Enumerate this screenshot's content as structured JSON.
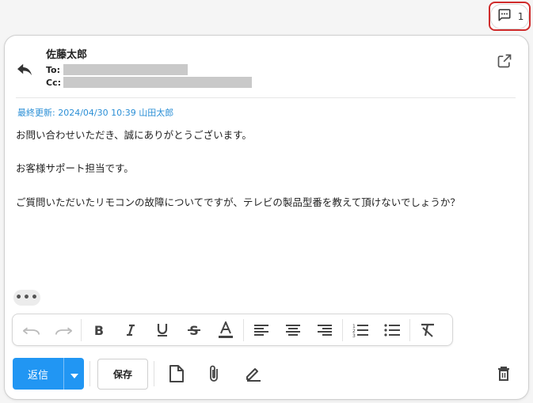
{
  "comments": {
    "count": "1",
    "icon": "comment-icon"
  },
  "message": {
    "sender": "佐藤太郎",
    "to_label": "To:",
    "cc_label": "Cc:",
    "last_updated": "最終更新: 2024/04/30 10:39 山田太郎",
    "body": [
      "お問い合わせいただき、誠にありがとうございます。",
      "お客様サポート担当です。",
      "ご質問いただいたリモコンの故障についてですが、テレビの製品型番を教えて頂けないでしょうか？"
    ],
    "more": "•••"
  },
  "toolbar": {
    "icons": [
      "undo-icon",
      "redo-icon",
      "bold-icon",
      "italic-icon",
      "underline-icon",
      "strikethrough-icon",
      "font-color-icon",
      "align-left-icon",
      "align-center-icon",
      "align-right-icon",
      "numbered-list-icon",
      "bulleted-list-icon",
      "clear-format-icon"
    ]
  },
  "actions": {
    "reply_label": "返信",
    "save_label": "保存",
    "icons": [
      "template-icon",
      "attach-icon",
      "signature-icon",
      "delete-icon"
    ]
  },
  "colors": {
    "accent": "#2196f3",
    "link": "#2b8fd6",
    "highlight": "#cf2c2c"
  }
}
